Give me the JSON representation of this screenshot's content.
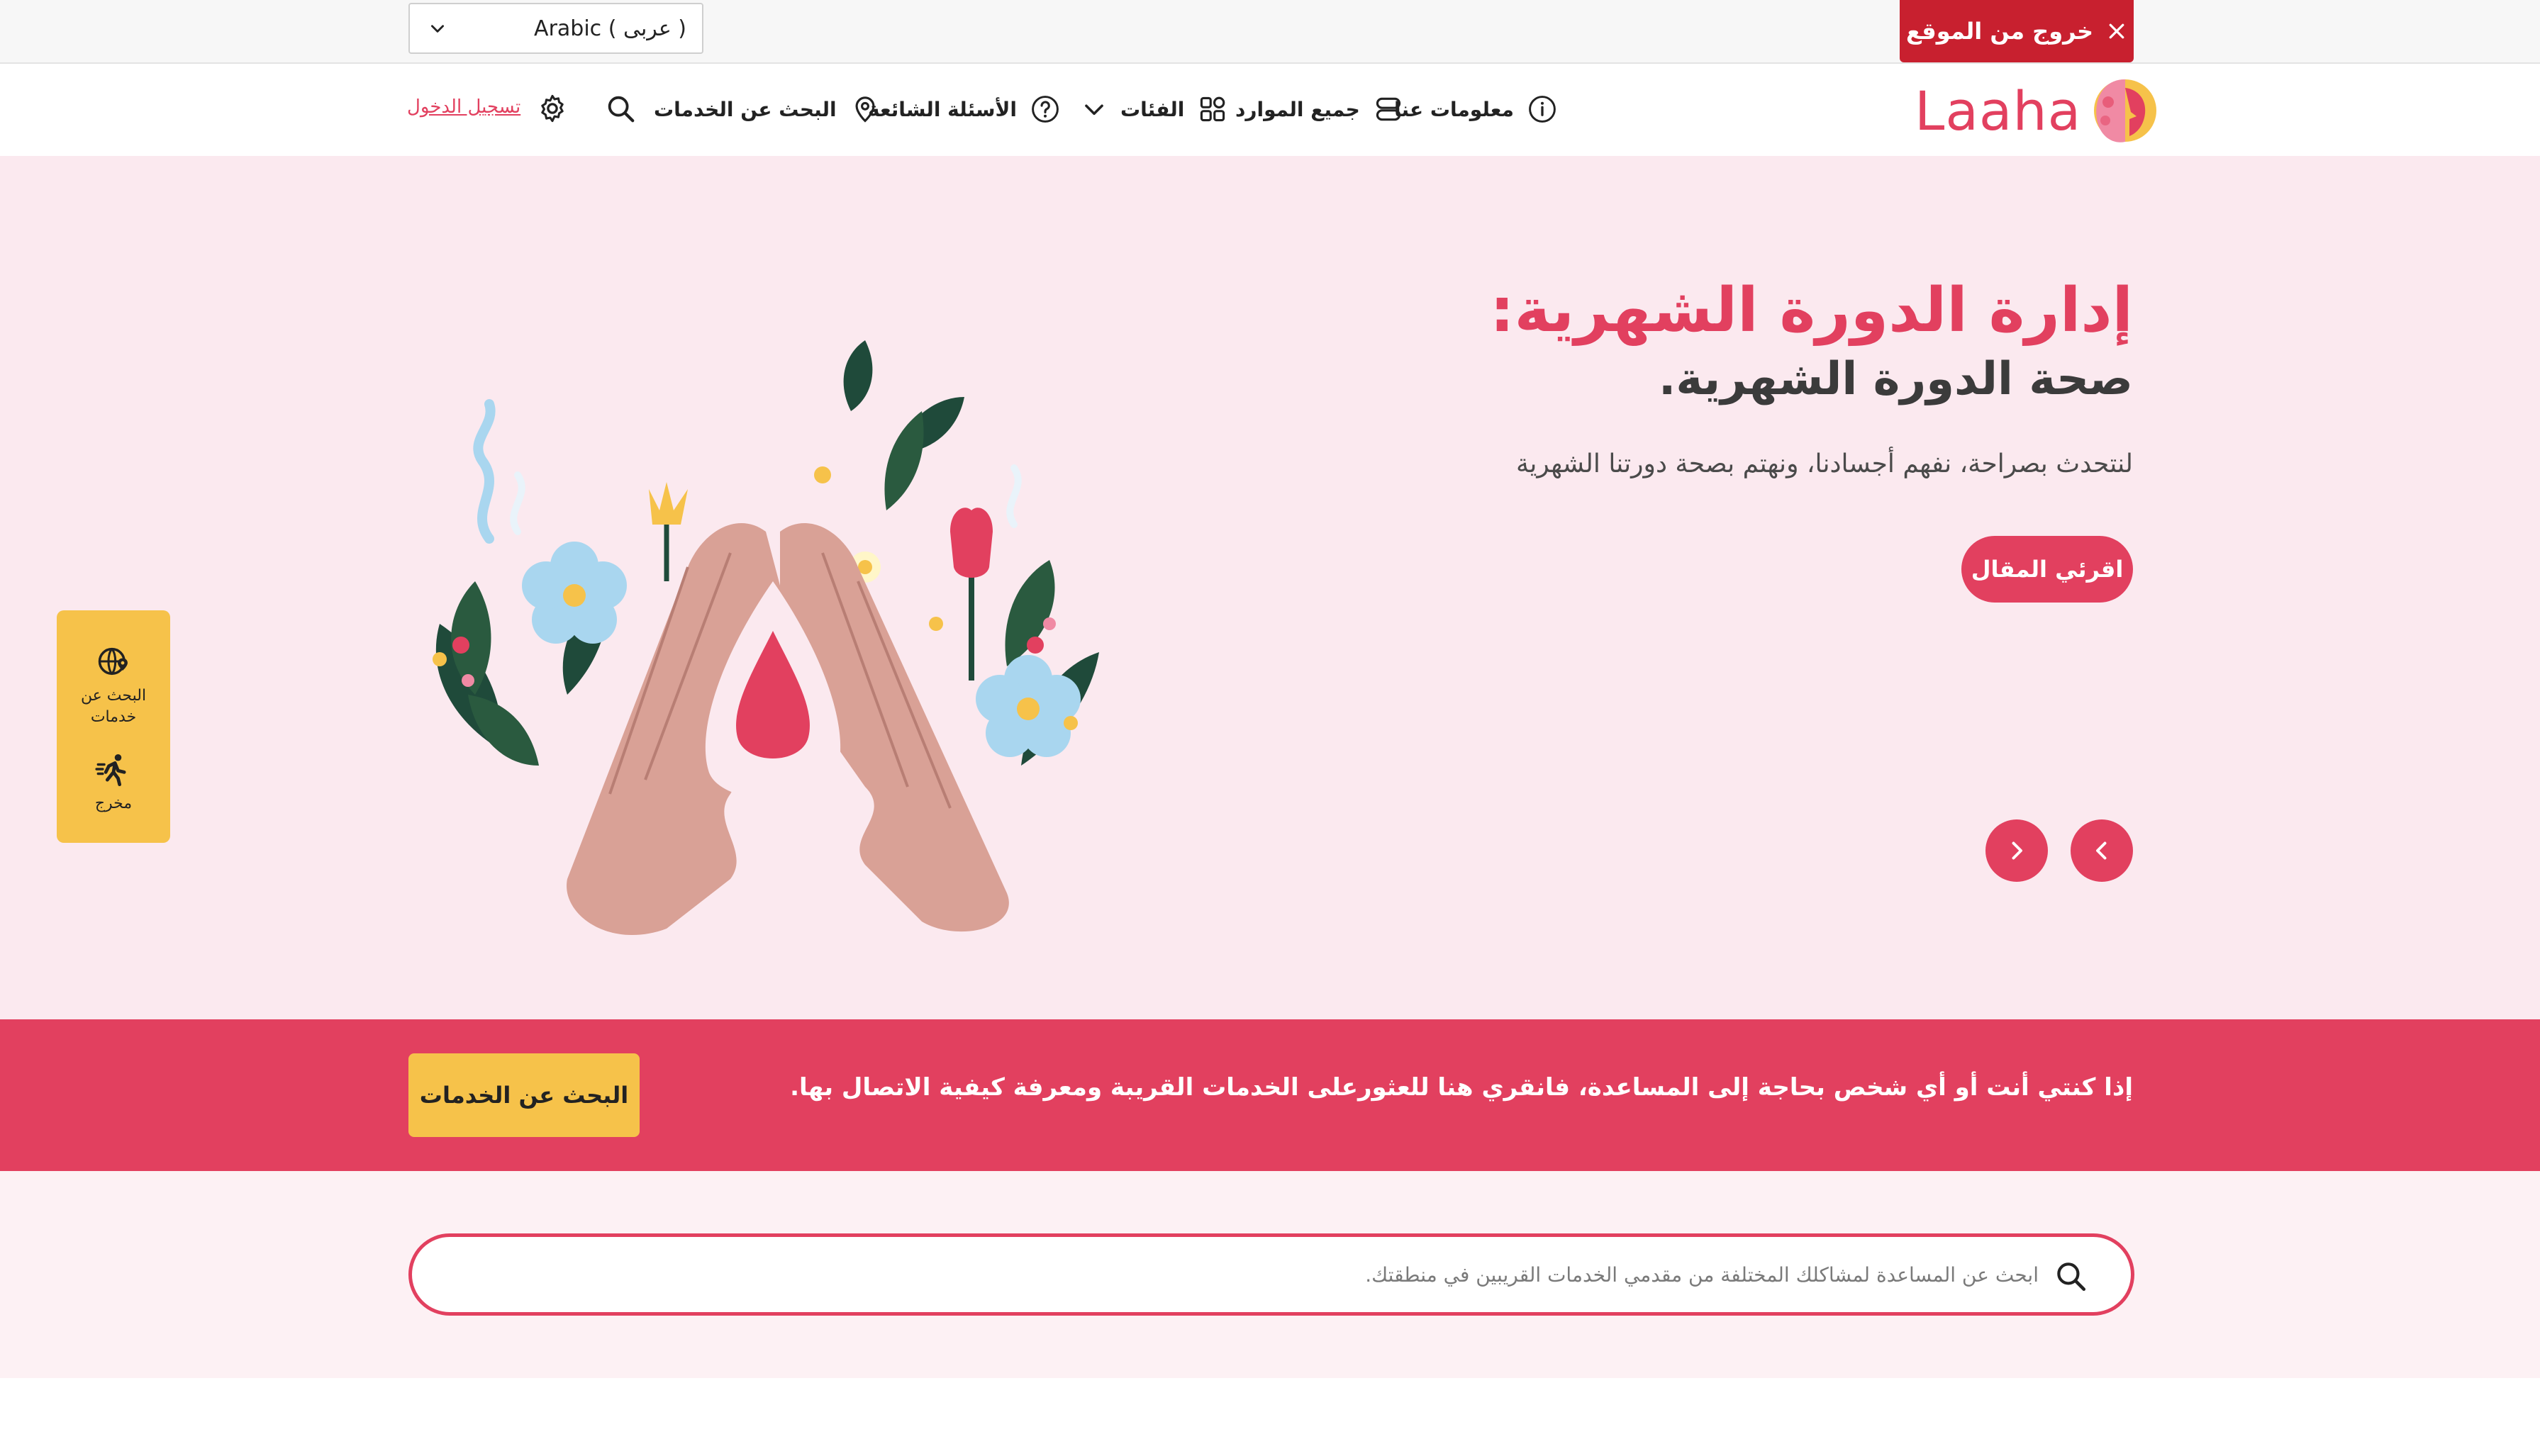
{
  "topbar": {
    "language_select": "Arabic ( عربى )",
    "exit_button": "خروج من الموقع"
  },
  "nav": {
    "logo": "Laaha",
    "about": "معلومات عنا",
    "all_resources": "جميع الموارد",
    "categories": "الفئات",
    "faq": "الأسئلة الشائعة",
    "find_services": "البحث عن الخدمات",
    "login": "تسجيل الدخول"
  },
  "hero": {
    "title": "إدارة الدورة الشهرية:",
    "subtitle": "صحة الدورة الشهرية.",
    "description": "لنتحدث بصراحة، نفهم أجسادنا، ونهتم بصحة دورتنا الشهرية",
    "read_button": "اقرئي المقال"
  },
  "side_widget": {
    "find_services_line1": "البحث عن",
    "find_services_line2": "خدمات",
    "exit": "مخرج"
  },
  "band": {
    "text": "إذا كنتي أنت أو أي شخص بحاجة إلى المساعدة، فانقري هنا للعثورعلى الخدمات القريبة ومعرفة كيفية الاتصال بها.",
    "button": "البحث عن الخدمات"
  },
  "search": {
    "placeholder": "ابحث عن المساعدة لمشاكلك المختلفة من مقدمي الخدمات القريبين في منطقتك."
  },
  "colors": {
    "brand_pink": "#e2405f",
    "exit_red": "#c8202f",
    "accent_yellow": "#f6c24a",
    "hero_bg": "#fbe9ef"
  }
}
